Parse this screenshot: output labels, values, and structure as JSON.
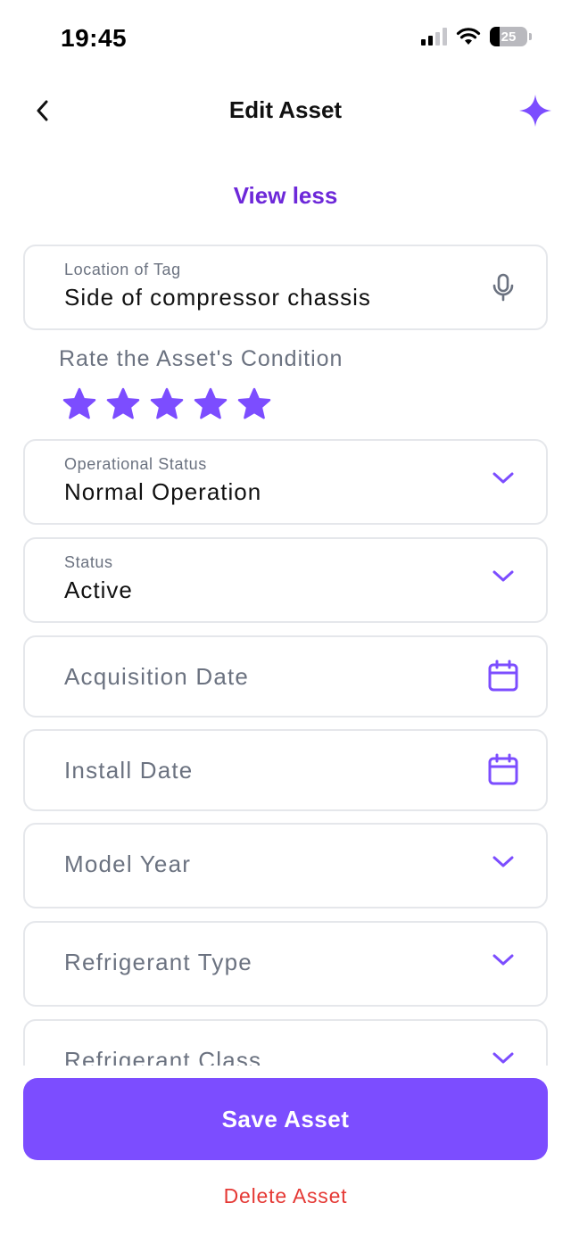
{
  "status_bar": {
    "time": "19:45",
    "battery_level": "25",
    "icons": [
      "cellular-signal-icon",
      "wifi-icon",
      "battery-icon"
    ]
  },
  "header": {
    "title": "Edit Asset",
    "back_icon": "chevron-left-icon",
    "assistant_icon": "sparkle-icon"
  },
  "toggle": {
    "view_less_label": "View less"
  },
  "fields": {
    "location_of_tag": {
      "label": "Location of Tag",
      "value": "Side of compressor chassis",
      "icon": "microphone-icon"
    },
    "operational_status": {
      "label": "Operational Status",
      "value": "Normal Operation",
      "icon": "chevron-down-icon"
    },
    "status": {
      "label": "Status",
      "value": "Active",
      "icon": "chevron-down-icon"
    },
    "acquisition_date": {
      "placeholder": "Acquisition Date",
      "icon": "calendar-icon"
    },
    "install_date": {
      "placeholder": "Install Date",
      "icon": "calendar-icon"
    },
    "model_year": {
      "placeholder": "Model Year",
      "icon": "chevron-down-icon"
    },
    "refrigerant_type": {
      "placeholder": "Refrigerant Type",
      "icon": "chevron-down-icon"
    },
    "refrigerant_class": {
      "placeholder": "Refrigerant Class",
      "icon": "chevron-down-icon"
    }
  },
  "condition": {
    "label": "Rate the Asset's Condition",
    "rating": 5,
    "max": 5
  },
  "actions": {
    "save_label": "Save Asset",
    "delete_label": "Delete Asset"
  },
  "colors": {
    "accent": "#7c4dff",
    "accent_dark": "#6d28d9",
    "danger": "#e53935",
    "border": "#e5e7eb",
    "muted_text": "#6b7280"
  }
}
